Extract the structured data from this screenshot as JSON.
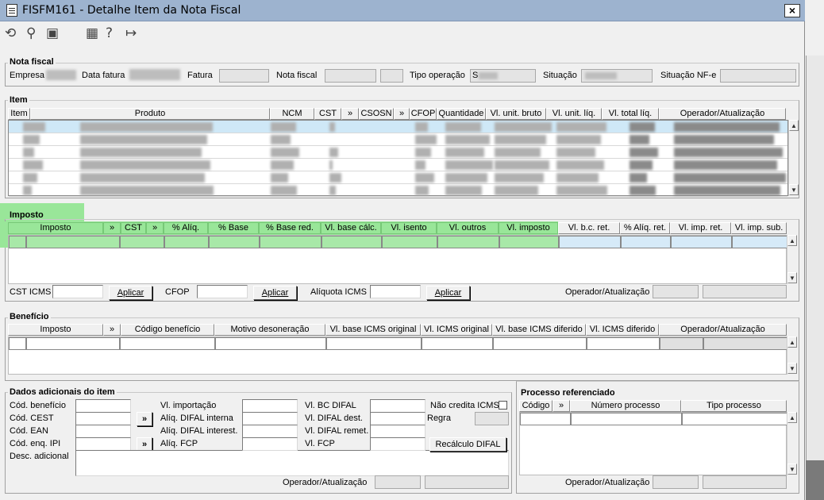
{
  "window": {
    "title": "FISFM161 - Detalhe Item da Nota Fiscal",
    "close_label": "×"
  },
  "toolbar": {
    "icons": [
      "refresh-icon",
      "search-icon",
      "save-icon",
      "calendar-icon",
      "help-icon",
      "exit-icon"
    ],
    "glyphs": [
      "⟲",
      "⚲",
      "▣",
      "▦",
      "?",
      "↦"
    ]
  },
  "nota_fiscal": {
    "title": "Nota fiscal",
    "empresa_label": "Empresa",
    "data_fatura_label": "Data fatura",
    "fatura_label": "Fatura",
    "nota_fiscal_label": "Nota fiscal",
    "tipo_operacao_label": "Tipo operação",
    "tipo_operacao_value": "S",
    "situacao_label": "Situação",
    "situacao_nfe_label": "Situação NF-e"
  },
  "item": {
    "title": "Item",
    "columns": [
      "Item",
      "Produto",
      "NCM",
      "CST",
      "»",
      "CSOSN",
      "»",
      "CFOP",
      "Quantidade",
      "Vl. unit. bruto",
      "Vl. unit. líq.",
      "Vl. total líq.",
      "Operador/Atualização"
    ]
  },
  "imposto": {
    "title": "Imposto",
    "columns": [
      "Imposto",
      "»",
      "CST",
      "»",
      "% Alíq.",
      "% Base",
      "% Base red.",
      "Vl. base cálc.",
      "Vl. isento",
      "Vl. outros",
      "Vl. imposto",
      "Vl. b.c. ret.",
      "% Alíq. ret.",
      "Vl. imp. ret.",
      "Vl. imp. sub."
    ],
    "cst_icms_label": "CST ICMS",
    "cfop_label": "CFOP",
    "aliquota_icms_label": "Alíquota ICMS",
    "aplicar_label": "Aplicar",
    "operador_label": "Operador/Atualização"
  },
  "beneficio": {
    "title": "Benefício",
    "columns": [
      "Imposto",
      "»",
      "Código benefício",
      "Motivo desoneração",
      "Vl. base ICMS original",
      "Vl. ICMS original",
      "Vl. base ICMS diferido",
      "Vl. ICMS diferido",
      "Operador/Atualização"
    ]
  },
  "dados_adicionais": {
    "title": "Dados adicionais do item",
    "cod_beneficio_label": "Cód. benefício",
    "cod_cest_label": "Cód. CEST",
    "cod_ean_label": "Cód. EAN",
    "cod_enq_ipi_label": "Cód. enq. IPI",
    "desc_adicional_label": "Desc. adicional",
    "vl_importacao_label": "Vl. importação",
    "aliq_difal_interna_label": "Alíq. DIFAL interna",
    "aliq_difal_interest_label": "Alíq. DIFAL interest.",
    "aliq_fcp_label": "Alíq. FCP",
    "vl_bc_difal_label": "Vl. BC DIFAL",
    "vl_difal_dest_label": "Vl. DIFAL dest.",
    "vl_difal_remet_label": "Vl. DIFAL remet.",
    "vl_fcp_label": "Vl. FCP",
    "nao_credita_icms_label": "Não credita ICMS",
    "regra_label": "Regra",
    "recalculo_difal_label": "Recálculo DIFAL",
    "operador_label": "Operador/Atualização",
    "lookup_label": "»"
  },
  "processo": {
    "title": "Processo referenciado",
    "columns": [
      "Código",
      "»",
      "Número processo",
      "Tipo processo"
    ],
    "operador_label": "Operador/Atualização"
  },
  "colors": {
    "title_bar": "#9db3cf",
    "imposto_highlight": "#99e699",
    "selected_row": "#cfe8f7"
  }
}
